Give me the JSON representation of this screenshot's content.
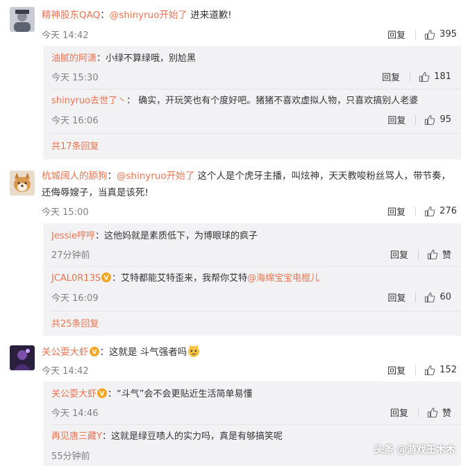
{
  "colors": {
    "username": "#eb7350",
    "meta": "#808080",
    "reply_bg": "#f2f2f5"
  },
  "comments": [
    {
      "user": "精神股东QAQ",
      "sep": "：",
      "mention": "@shinyruo开始了",
      "text": " 进来道歉!",
      "time": "今天 14:42",
      "reply_label": "回复",
      "likes": "395",
      "replies": [
        {
          "user": "油腻的阿潇",
          "text": "：小绿不算绿哦，别尬黑",
          "time": "今天 15:30",
          "reply_label": "回复",
          "likes": "181"
        },
        {
          "user": "shinyruo去世了丶",
          "text": "： 确实，开玩笑也有个度好吧。猪猪不喜欢虚拟人物，只喜欢搞别人老婆",
          "time": "今天 16:06",
          "reply_label": "回复",
          "likes": "95"
        }
      ],
      "more": "共17条回复"
    },
    {
      "user": "杭城阔人的舔狗",
      "sep": "：",
      "mention": "@shinyruo开始了",
      "text": " 这个人是个虎牙主播，叫炫神，天天教唆粉丝骂人，带节奏，",
      "text2": "还侮辱嫂子，当真是该死!",
      "time": "今天 15:00",
      "reply_label": "回复",
      "likes": "276",
      "replies": [
        {
          "user": "Jessie哼哼",
          "text": "：这他妈就是素质低下，为博眼球的疯子",
          "time": "27分钟前",
          "reply_label": "回复",
          "likes": "赞"
        },
        {
          "user": "JCAL0R13S",
          "text": "：艾特都能艾特歪来，我帮你艾特",
          "mention": "@海绵宝宝电棍儿",
          "time": "今天 16:09",
          "reply_label": "回复",
          "likes": "60"
        }
      ],
      "more": "共25条回复"
    },
    {
      "user": "关公耍大虾",
      "sep": "：",
      "text": "这就是  斗气强者吗",
      "time": "今天 14:42",
      "reply_label": "回复",
      "likes": "152",
      "replies": [
        {
          "user": "关公耍大虾",
          "text": "：“斗气”会不会更贴近生活简单易懂",
          "time": "今天 14:46",
          "reply_label": "回复",
          "likes": "赞"
        },
        {
          "user": "再见唐三藏Y",
          "text": "：这就是绿豆啧人的实力吗，真是有够搞笑呢",
          "time": "55分钟前",
          "reply_label": "",
          "likes": ""
        }
      ]
    }
  ],
  "watermark": "头条 @游戏王木木"
}
